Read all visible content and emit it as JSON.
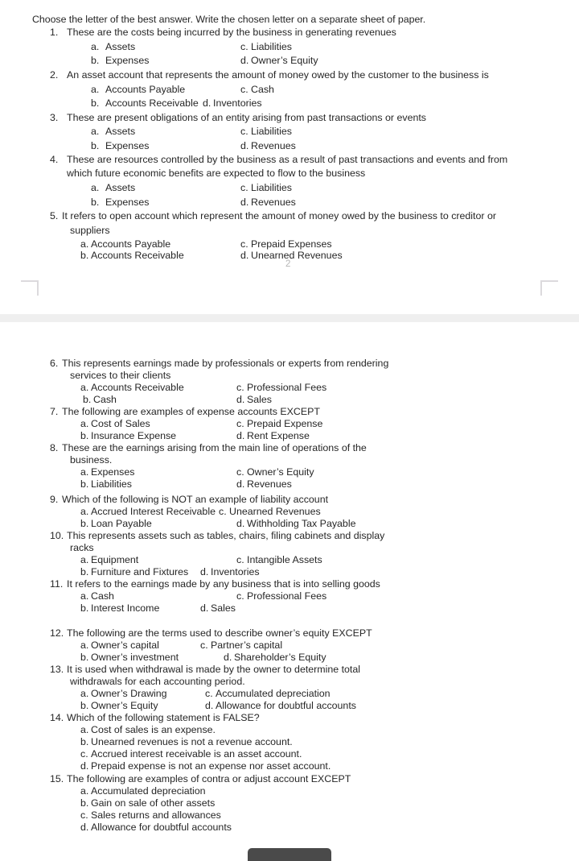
{
  "document": {
    "instruction": "Choose the letter of the best answer. Write the chosen letter on a separate sheet of paper.",
    "page_number": "2",
    "page_one": {
      "questions": [
        {
          "number": "1.",
          "stem": "These are the costs being incurred by the business in generating revenues",
          "stem2": "",
          "options": [
            {
              "key": "a.",
              "text": "Assets"
            },
            {
              "key": "c.",
              "text": "Liabilities"
            },
            {
              "key": "b.",
              "text": "Expenses"
            },
            {
              "key": "d.",
              "text": "Owner’s Equity"
            }
          ]
        },
        {
          "number": "2.",
          "stem": "An asset account that represents the amount of money owed by the customer to the business is",
          "stem2": "",
          "options": [
            {
              "key": "a.",
              "text": "Accounts Payable"
            },
            {
              "key": "c.",
              "text": "Cash"
            },
            {
              "key": "b.",
              "text": "Accounts Receivable"
            },
            {
              "key": "d.",
              "text": "Inventories"
            }
          ]
        },
        {
          "number": "3.",
          "stem": "These are present obligations of an entity arising from past transactions or events",
          "stem2": "",
          "options": [
            {
              "key": "a.",
              "text": "Assets"
            },
            {
              "key": "c.",
              "text": "Liabilities"
            },
            {
              "key": "b.",
              "text": "Expenses"
            },
            {
              "key": "d.",
              "text": "Revenues"
            }
          ]
        },
        {
          "number": "4.",
          "stem": "These are resources controlled by the business as a result of past transactions and events and from",
          "stem2": "which future economic benefits are expected to flow to the business",
          "options": [
            {
              "key": "a.",
              "text": "Assets"
            },
            {
              "key": "c.",
              "text": "Liabilities"
            },
            {
              "key": "b.",
              "text": "Expenses"
            },
            {
              "key": "d.",
              "text": "Revenues"
            }
          ]
        },
        {
          "number": "5.",
          "stem": "It refers to open account which represent the amount of money owed by the business to creditor or",
          "stem2": "suppliers",
          "options": [
            {
              "key": "a.",
              "text": "Accounts Payable"
            },
            {
              "key": "c.",
              "text": "Prepaid Expenses"
            },
            {
              "key": "b.",
              "text": "Accounts Receivable"
            },
            {
              "key": "d.",
              "text": "Unearned Revenues"
            }
          ]
        }
      ]
    },
    "page_two": {
      "questions": [
        {
          "number": "6.",
          "stem": "This represents earnings made by professionals or experts from rendering",
          "stem2": "services to their clients",
          "options": [
            {
              "key": "a.",
              "text": "Accounts Receivable"
            },
            {
              "key": "c.",
              "text": "Professional Fees"
            },
            {
              "key": "b.",
              "text": "Cash"
            },
            {
              "key": "d.",
              "text": "Sales"
            }
          ]
        },
        {
          "number": "7.",
          "stem": "The following are examples of expense accounts EXCEPT",
          "stem2": "",
          "options": [
            {
              "key": "a.",
              "text": "Cost of Sales"
            },
            {
              "key": "c.",
              "text": "Prepaid Expense"
            },
            {
              "key": "b.",
              "text": "Insurance Expense"
            },
            {
              "key": "d.",
              "text": "Rent Expense"
            }
          ]
        },
        {
          "number": "8.",
          "stem": "These are the earnings arising from the main line of operations of the",
          "stem2": "business.",
          "options": [
            {
              "key": "a.",
              "text": "Expenses"
            },
            {
              "key": "c.",
              "text": "Owner’s Equity"
            },
            {
              "key": "b.",
              "text": "Liabilities"
            },
            {
              "key": "d.",
              "text": "Revenues"
            }
          ]
        },
        {
          "number": "9.",
          "stem": "Which of the following is NOT an example of liability account",
          "stem2": "",
          "options": [
            {
              "key": "a.",
              "text": "Accrued Interest Receivable"
            },
            {
              "key": "c.",
              "text": "Unearned Revenues"
            },
            {
              "key": "b.",
              "text": "Loan Payable"
            },
            {
              "key": "d.",
              "text": "Withholding Tax Payable"
            }
          ]
        },
        {
          "number": "10.",
          "stem": "This represents assets such as tables, chairs, filing cabinets and display",
          "stem2": "racks",
          "options": [
            {
              "key": "a.",
              "text": "Equipment"
            },
            {
              "key": "c.",
              "text": "Intangible Assets"
            },
            {
              "key": "b.",
              "text": "Furniture and Fixtures"
            },
            {
              "key": "d.",
              "text": "Inventories"
            }
          ]
        },
        {
          "number": "11.",
          "stem": "It refers to the earnings made by any business that is into selling goods",
          "stem2": "",
          "options": [
            {
              "key": "a.",
              "text": "Cash"
            },
            {
              "key": "c.",
              "text": "Professional Fees"
            },
            {
              "key": "b.",
              "text": "Interest Income"
            },
            {
              "key": "d.",
              "text": "Sales"
            }
          ]
        },
        {
          "number": "12.",
          "stem": "The following are the terms used to describe owner’s equity EXCEPT",
          "stem2": "",
          "options": [
            {
              "key": "a.",
              "text": "Owner’s capital"
            },
            {
              "key": "c.",
              "text": "Partner’s capital"
            },
            {
              "key": "b.",
              "text": "Owner’s investment"
            },
            {
              "key": "d.",
              "text": "Shareholder’s Equity"
            }
          ]
        },
        {
          "number": "13.",
          "stem": "It is used when withdrawal is made by the owner to determine total",
          "stem2": "withdrawals for each accounting period.",
          "options": [
            {
              "key": "a.",
              "text": "Owner’s Drawing"
            },
            {
              "key": "c.",
              "text": "Accumulated depreciation"
            },
            {
              "key": "b.",
              "text": "Owner’s Equity"
            },
            {
              "key": "d.",
              "text": "Allowance for doubtful accounts"
            }
          ]
        },
        {
          "number": "14.",
          "stem": "Which of the following statement is FALSE?",
          "stem2": "",
          "options": [
            {
              "key": "a.",
              "text": "Cost of sales is an expense."
            },
            {
              "key": "b.",
              "text": "Unearned revenues is not a revenue account."
            },
            {
              "key": "c.",
              "text": "Accrued interest receivable is an asset account."
            },
            {
              "key": "d.",
              "text": "Prepaid expense is not an expense nor asset account."
            }
          ]
        },
        {
          "number": "15.",
          "stem": "The following are examples of contra or adjust account EXCEPT",
          "stem2": "",
          "options": [
            {
              "key": "a.",
              "text": "Accumulated depreciation"
            },
            {
              "key": "b.",
              "text": "Gain on sale of other assets"
            },
            {
              "key": "c.",
              "text": "Sales returns and allowances"
            },
            {
              "key": "d.",
              "text": "Allowance for doubtful accounts"
            }
          ]
        }
      ]
    }
  }
}
